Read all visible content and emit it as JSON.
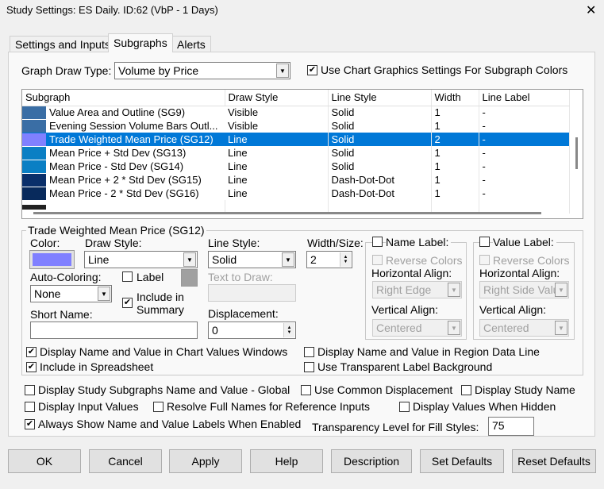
{
  "window": {
    "title": "Study Settings: ES Daily. ID:62 (VbP - 1 Days)",
    "close": "✕"
  },
  "tabs": [
    {
      "label": "Settings and Inputs",
      "active": false
    },
    {
      "label": "Subgraphs",
      "active": true
    },
    {
      "label": "Alerts",
      "active": false
    }
  ],
  "graph_draw_type": {
    "label": "Graph Draw Type:",
    "value": "Volume by Price"
  },
  "use_chart_graphics": {
    "label": "Use Chart Graphics Settings For Subgraph Colors",
    "checked": true
  },
  "table": {
    "headers": [
      "Subgraph",
      "Draw Style",
      "Line Style",
      "Width",
      "Line Label"
    ],
    "rows": [
      {
        "color": "#3a6ea5",
        "name": "Value Area and Outline (SG9)",
        "draw": "Visible",
        "line": "Solid",
        "width": "1",
        "label": "-"
      },
      {
        "color": "#3a6ea5",
        "name": "Evening Session Volume Bars Outl...",
        "draw": "Visible",
        "line": "Solid",
        "width": "1",
        "label": "-"
      },
      {
        "color": "#8080ff",
        "name": "Trade Weighted Mean Price (SG12)",
        "draw": "Line",
        "line": "Solid",
        "width": "2",
        "label": "-",
        "selected": true
      },
      {
        "color": "#0a7fc4",
        "name": "Mean Price + Std Dev (SG13)",
        "draw": "Line",
        "line": "Solid",
        "width": "1",
        "label": "-"
      },
      {
        "color": "#0a7fc4",
        "name": "Mean Price - Std Dev (SG14)",
        "draw": "Line",
        "line": "Solid",
        "width": "1",
        "label": "-"
      },
      {
        "color": "#0a2f6a",
        "name": "Mean Price + 2 * Std Dev (SG15)",
        "draw": "Line",
        "line": "Dash-Dot-Dot",
        "width": "1",
        "label": "-"
      },
      {
        "color": "#082a5c",
        "name": "Mean Price - 2 * Std Dev (SG16)",
        "draw": "Line",
        "line": "Dash-Dot-Dot",
        "width": "1",
        "label": "-"
      }
    ]
  },
  "detail": {
    "group_title": "Trade Weighted Mean Price (SG12)",
    "color_label": "Color:",
    "color_value": "#8080ff",
    "draw_style_label": "Draw Style:",
    "draw_style": "Line",
    "line_style_label": "Line Style:",
    "line_style": "Solid",
    "width_label": "Width/Size:",
    "width": "2",
    "auto_coloring_label": "Auto-Coloring:",
    "auto_coloring": "None",
    "label_cb": "Label",
    "include_summary": "Include in Summary",
    "text_to_draw": "Text to Draw:",
    "short_name_label": "Short Name:",
    "short_name": "",
    "displacement_label": "Displacement:",
    "displacement": "0",
    "name_label": {
      "title": "Name Label:",
      "reverse": "Reverse Colors",
      "h_label": "Horizontal Align:",
      "h": "Right Edge",
      "v_label": "Vertical Align:",
      "v": "Centered"
    },
    "value_label": {
      "title": "Value Label:",
      "reverse": "Reverse Colors",
      "h_label": "Horizontal Align:",
      "h": "Right Side Valu",
      "v_label": "Vertical Align:",
      "v": "Centered"
    },
    "display_chart_values": "Display Name and Value in Chart Values Windows",
    "include_spreadsheet": "Include in Spreadsheet",
    "display_region": "Display Name and Value in Region Data Line",
    "transparent_bg": "Use Transparent Label Background"
  },
  "options": {
    "global": "Display Study Subgraphs Name and Value - Global",
    "common_disp": "Use Common Displacement",
    "study_name": "Display Study Name",
    "input_values": "Display Input Values",
    "resolve": "Resolve Full Names for Reference Inputs",
    "hidden": "Display Values When Hidden",
    "always_show": "Always Show Name and Value Labels When Enabled",
    "transparency_label": "Transparency Level for Fill Styles:",
    "transparency": "75"
  },
  "buttons": [
    "OK",
    "Cancel",
    "Apply",
    "Help",
    "Description",
    "Set Defaults",
    "Reset Defaults"
  ]
}
